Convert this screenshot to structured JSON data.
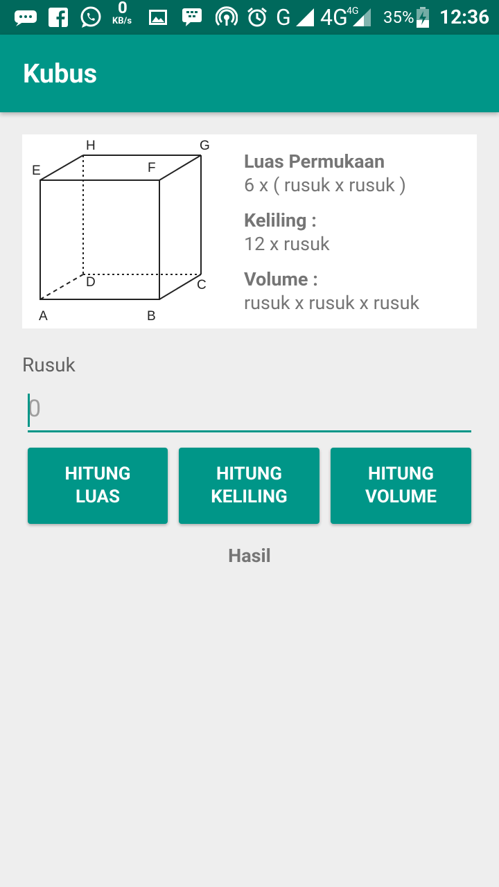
{
  "status_bar": {
    "network_speed": "0",
    "network_unit": "KB/s",
    "network_g": "G",
    "network_4g": "4G",
    "network_4g_small": "4G",
    "battery": "35%",
    "time": "12:36",
    "icons": [
      "messages-icon",
      "facebook-icon",
      "whatsapp-icon",
      "gallery-icon",
      "bbm-icon",
      "hotspot-icon",
      "alarm-icon",
      "signal-icon",
      "battery-icon"
    ]
  },
  "app_bar": {
    "title": "Kubus"
  },
  "diagram": {
    "labels": {
      "A": "A",
      "B": "B",
      "C": "C",
      "D": "D",
      "E": "E",
      "F": "F",
      "G": "G",
      "H": "H"
    }
  },
  "formulas": {
    "luas_title": "Luas Permukaan",
    "luas_body": "6 x ( rusuk x rusuk )",
    "keliling_title": "Keliling :",
    "keliling_body": "12 x rusuk",
    "volume_title": "Volume :",
    "volume_body": "rusuk x rusuk x rusuk"
  },
  "input": {
    "label": "Rusuk",
    "placeholder": "0",
    "value": ""
  },
  "buttons": {
    "luas_line1": "HITUNG",
    "luas_line2": "LUAS",
    "keliling_line1": "HITUNG",
    "keliling_line2": "KELILING",
    "volume_line1": "HITUNG",
    "volume_line2": "VOLUME"
  },
  "result": {
    "label": "Hasil"
  },
  "colors": {
    "primary": "#009688",
    "primary_dark": "#00695c",
    "background": "#eeeeee",
    "text_secondary": "#757575"
  }
}
